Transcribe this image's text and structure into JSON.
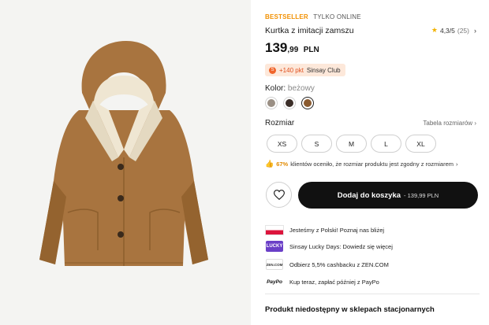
{
  "product": {
    "tag_bestseller": "BESTSELLER",
    "tag_online": "TYLKO ONLINE",
    "title": "Kurtka z imitacji zamszu",
    "rating": "4,3/5",
    "rating_count": "(25)",
    "price_main": "139",
    "price_decimals": ",99",
    "currency": "PLN"
  },
  "club": {
    "points": "+140 pkt",
    "name": "Sinsay Club",
    "accent": "#f0642a"
  },
  "color": {
    "label": "Kolor:",
    "value": "beżowy",
    "swatches": [
      {
        "name": "grey-brown",
        "hex": "#9a8f84"
      },
      {
        "name": "dark-brown",
        "hex": "#3b2e28"
      },
      {
        "name": "beige",
        "hex": "#8a5a2f",
        "selected": true
      }
    ]
  },
  "size": {
    "label": "Rozmiar",
    "guide": "Tabela rozmiarów",
    "options": [
      "XS",
      "S",
      "M",
      "L",
      "XL"
    ]
  },
  "fit": {
    "percent": "67%",
    "text": "klientów oceniło, że rozmiar produktu jest zgodny z rozmiarem"
  },
  "cart": {
    "label": "Dodaj do koszyka",
    "price": "- 139,99 PLN"
  },
  "promos": [
    {
      "icon": "polish-flag-icon",
      "text": "Jesteśmy z Polski! Poznaj nas bliżej"
    },
    {
      "icon": "lucky-days-icon",
      "text": "Sinsay Lucky Days: Dowiedz się więcej",
      "badge": "LUCKY"
    },
    {
      "icon": "zen-icon",
      "text": "Odbierz 5,5% cashbacku z ZEN.COM",
      "badge": "ZEN.COM"
    },
    {
      "icon": "paypo-icon",
      "text": "Kup teraz, zapłać później z PayPo",
      "badge": "PayPo"
    }
  ],
  "store": {
    "unavailable": "Produkt niedostępny w sklepach stacjonarnych"
  },
  "colors": {
    "accent_orange": "#f29000",
    "button_dark": "#111111",
    "jacket_brown": "#a8743f"
  }
}
